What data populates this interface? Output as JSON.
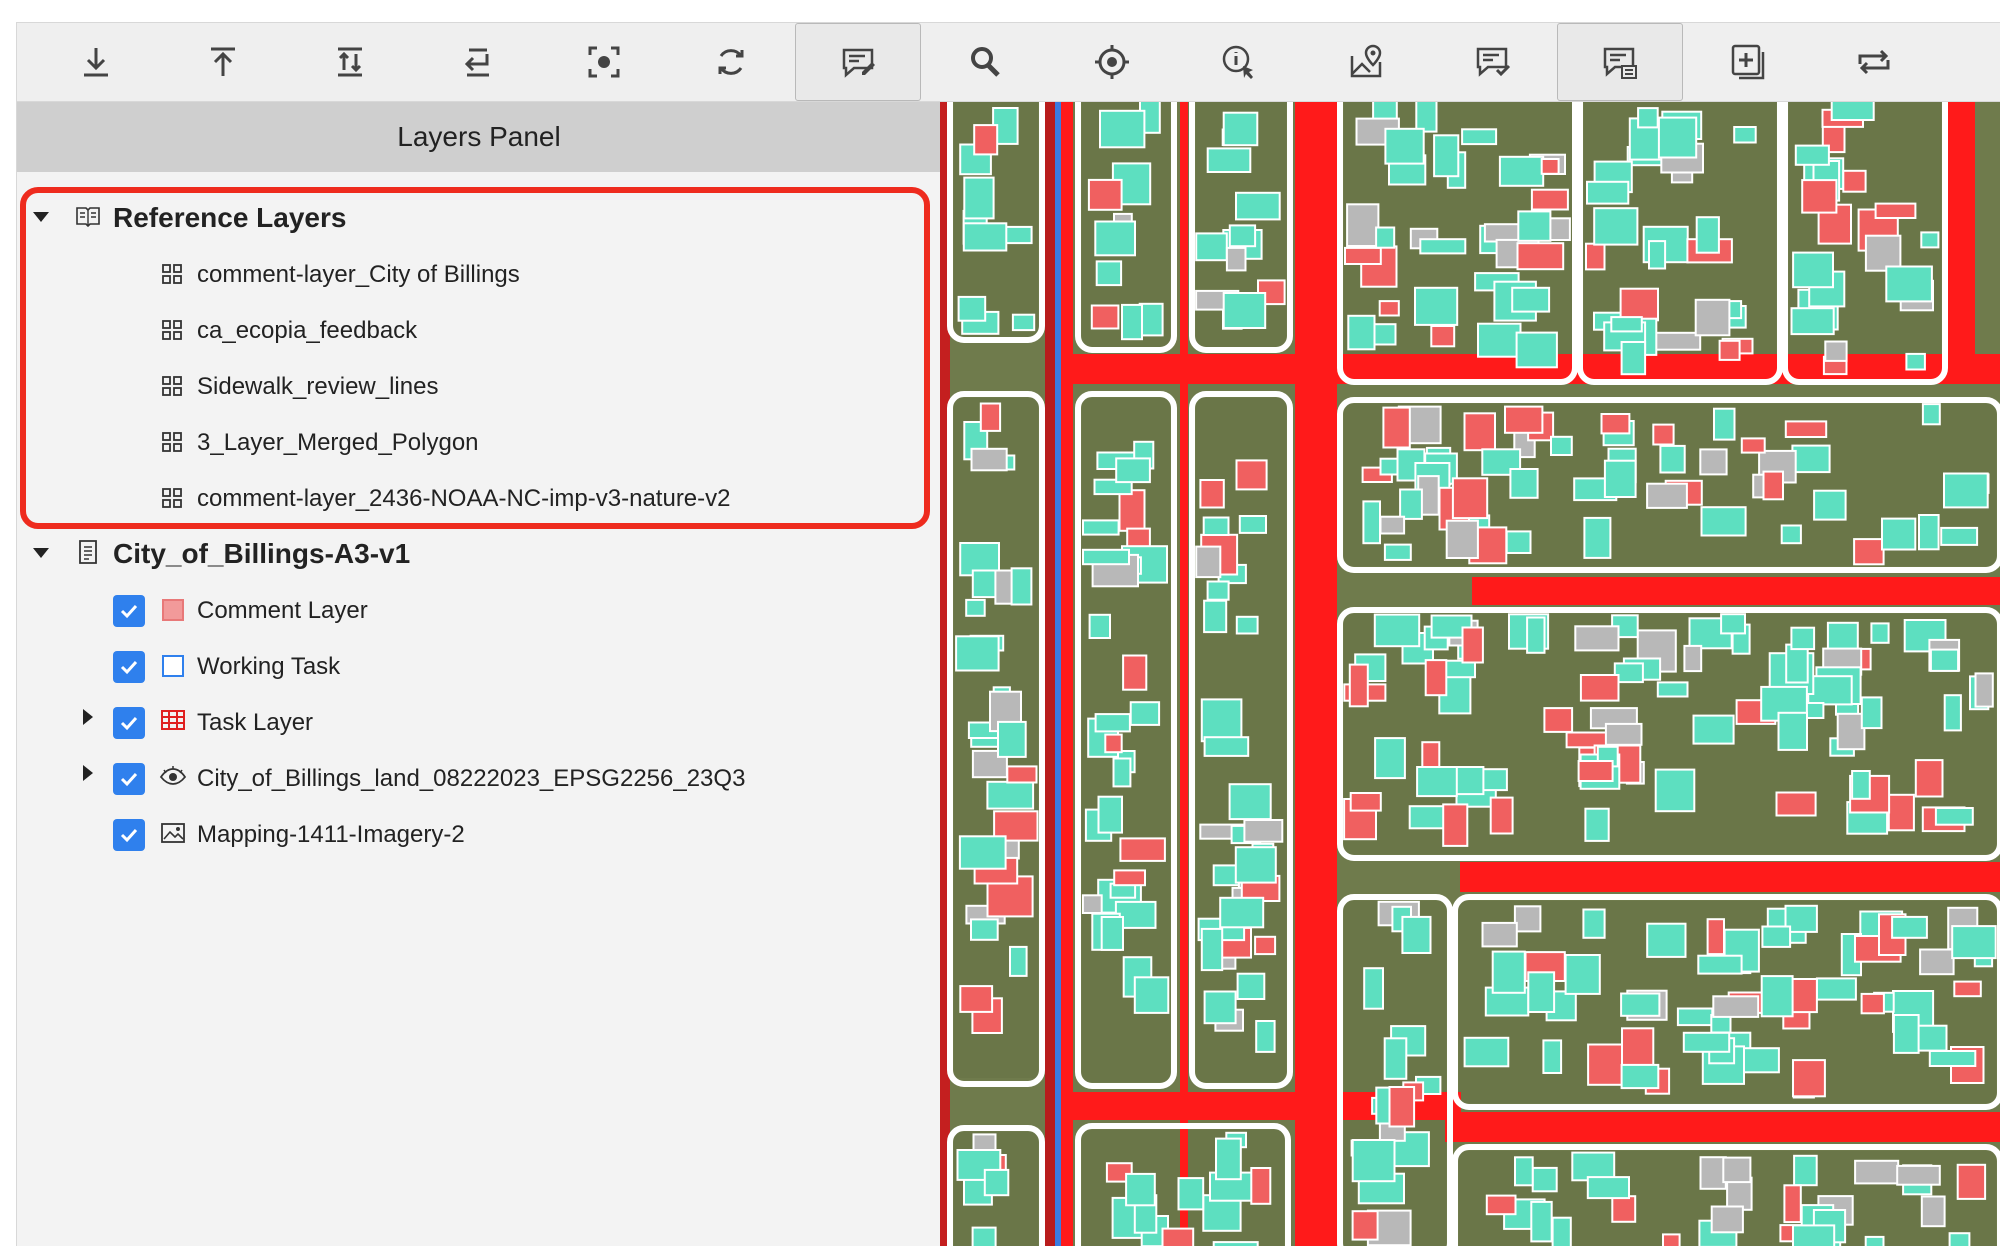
{
  "toolbar": {
    "tools": [
      {
        "name": "download-icon",
        "active": false
      },
      {
        "name": "upload-icon",
        "active": false
      },
      {
        "name": "sort-icon",
        "active": false
      },
      {
        "name": "return-icon",
        "active": false
      },
      {
        "name": "focus-icon",
        "active": false
      },
      {
        "name": "refresh-icon",
        "active": false
      },
      {
        "name": "comment-edit-icon",
        "active": true
      },
      {
        "name": "search-icon",
        "active": false
      },
      {
        "name": "target-icon",
        "active": false
      },
      {
        "name": "info-cursor-icon",
        "active": false
      },
      {
        "name": "map-pin-icon",
        "active": false
      },
      {
        "name": "comment-check-icon",
        "active": false
      },
      {
        "name": "comment-list-icon",
        "active": true
      },
      {
        "name": "add-square-icon",
        "active": false
      },
      {
        "name": "swap-icon",
        "active": false
      }
    ]
  },
  "panel": {
    "title": "Layers Panel",
    "reference_group": {
      "title": "Reference Layers",
      "icon": "book-icon",
      "items": [
        {
          "label": "comment-layer_City of Billings",
          "icon": "grid-icon"
        },
        {
          "label": "ca_ecopia_feedback",
          "icon": "grid-icon"
        },
        {
          "label": "Sidewalk_review_lines",
          "icon": "grid-icon"
        },
        {
          "label": "3_Layer_Merged_Polygon",
          "icon": "grid-icon"
        },
        {
          "label": "comment-layer_2436-NOAA-NC-imp-v3-nature-v2",
          "icon": "grid-icon"
        }
      ]
    },
    "project_group": {
      "title": "City_of_Billings-A3-v1",
      "icon": "document-icon",
      "items": [
        {
          "label": "Comment Layer",
          "icon": "pink-square-icon",
          "checked": true,
          "expandable": false
        },
        {
          "label": "Working Task",
          "icon": "blue-square-icon",
          "checked": true,
          "expandable": false
        },
        {
          "label": "Task Layer",
          "icon": "red-grid-icon",
          "checked": true,
          "expandable": true
        },
        {
          "label": "City_of_Billings_land_08222023_EPSG2256_23Q3",
          "icon": "eye-icon",
          "checked": true,
          "expandable": true
        },
        {
          "label": "Mapping-1411-Imagery-2",
          "icon": "image-icon",
          "checked": true,
          "expandable": false
        }
      ]
    }
  },
  "colors": {
    "accent": "#2f80ed",
    "highlight": "#ee2b1e",
    "road": "#ff1a1a",
    "building": "#5ddfc0",
    "pavement": "#f06060",
    "gray": "#b8b8b8"
  }
}
